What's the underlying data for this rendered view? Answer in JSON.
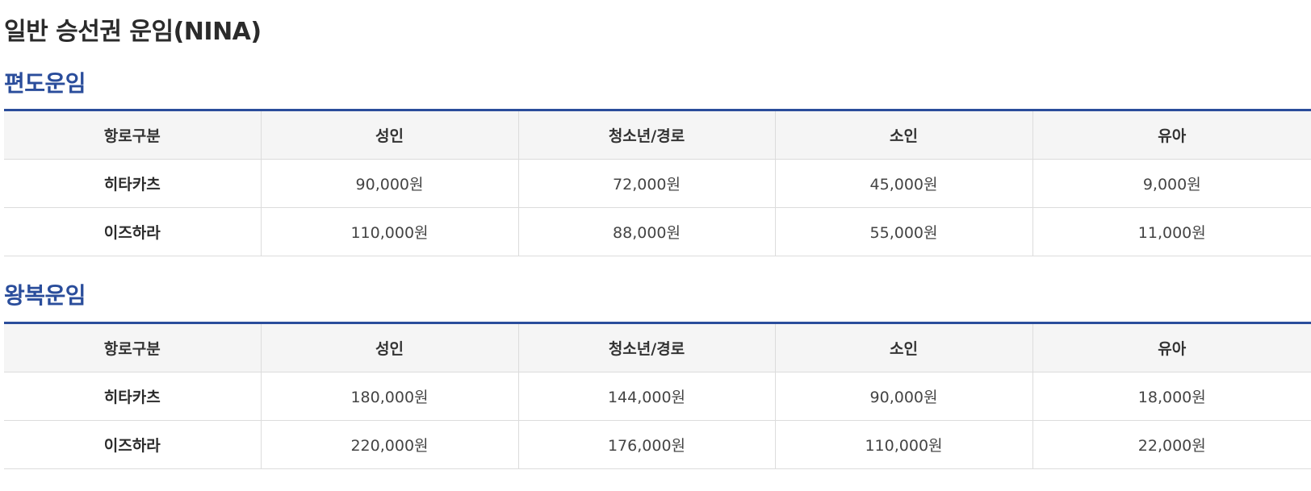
{
  "page_title": "일반 승선권 운임(NINA)",
  "sections": [
    {
      "title": "편도운임",
      "headers": [
        "항로구분",
        "성인",
        "청소년/경로",
        "소인",
        "유아"
      ],
      "rows": [
        {
          "route": "히타카츠",
          "fares": [
            "90,000원",
            "72,000원",
            "45,000원",
            "9,000원"
          ]
        },
        {
          "route": "이즈하라",
          "fares": [
            "110,000원",
            "88,000원",
            "55,000원",
            "11,000원"
          ]
        }
      ]
    },
    {
      "title": "왕복운임",
      "headers": [
        "항로구분",
        "성인",
        "청소년/경로",
        "소인",
        "유아"
      ],
      "rows": [
        {
          "route": "히타카츠",
          "fares": [
            "180,000원",
            "144,000원",
            "90,000원",
            "18,000원"
          ]
        },
        {
          "route": "이즈하라",
          "fares": [
            "220,000원",
            "176,000원",
            "110,000원",
            "22,000원"
          ]
        }
      ]
    }
  ],
  "colors": {
    "accent": "#2a4d9b",
    "header_bg": "#f5f5f5",
    "border": "#dcdcdc"
  }
}
